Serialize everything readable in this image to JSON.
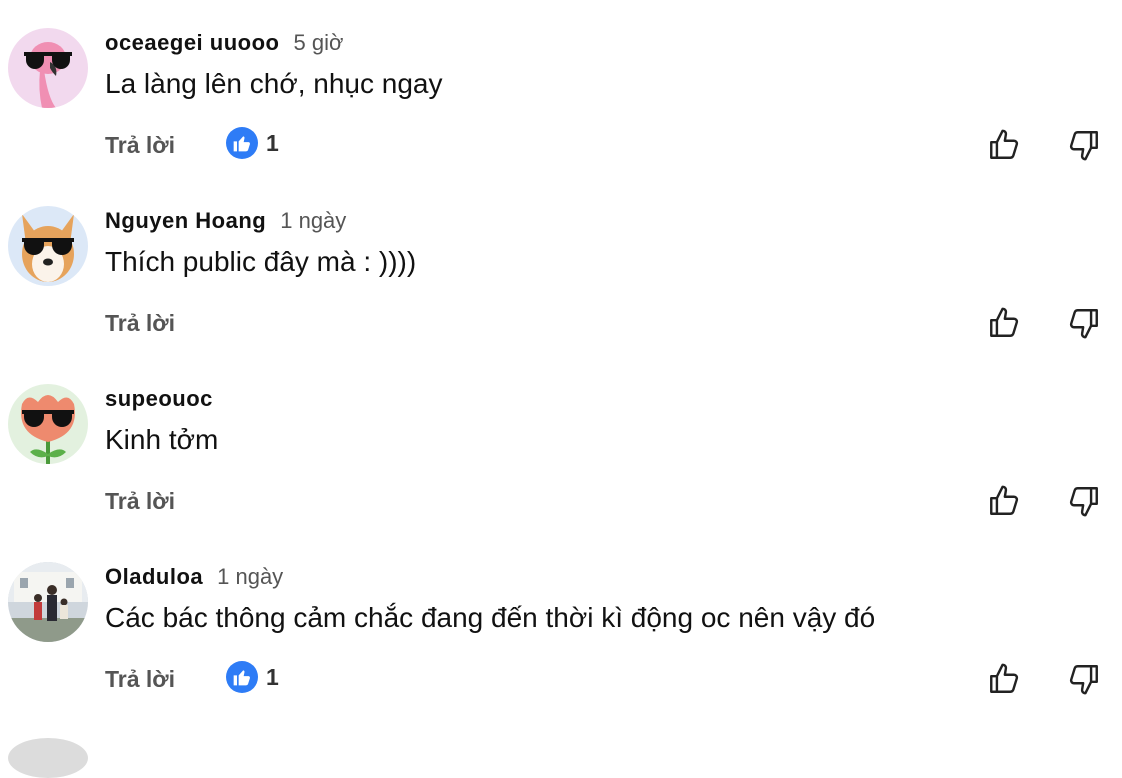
{
  "comments": [
    {
      "author": "oceaegei uuooo",
      "time": "5 giờ",
      "text": "La làng lên chớ, nhục ngay",
      "reply_label": "Trả lời",
      "like_count": "1",
      "avatar_icon": "flamingo-sunglasses-avatar",
      "avatar_bg": "#f2d9ee"
    },
    {
      "author": "Nguyen Hoang",
      "time": "1 ngày",
      "text": "Thích public đây mà : ))))",
      "reply_label": "Trả lời",
      "like_count": null,
      "avatar_icon": "dog-sunglasses-avatar",
      "avatar_bg": "#dce8f7"
    },
    {
      "author": "supeouoc",
      "time": "",
      "text": "Kinh tởm",
      "reply_label": "Trả lời",
      "like_count": null,
      "avatar_icon": "flower-sunglasses-avatar",
      "avatar_bg": "#e3f1df"
    },
    {
      "author": "Oladuloa",
      "time": "1 ngày",
      "text": "Các bác thông cảm chắc đang đến thời kì động oc nên vậy đó",
      "reply_label": "Trả lời",
      "like_count": "1",
      "avatar_icon": "family-photo-avatar",
      "avatar_bg": "#cfd6dd"
    }
  ],
  "icons": {
    "like": "thumbs-up-icon",
    "dislike": "thumbs-down-icon",
    "like_badge": "like-badge-icon"
  },
  "colors": {
    "accent_blue": "#2e7cf6",
    "text_secondary": "#555555"
  }
}
